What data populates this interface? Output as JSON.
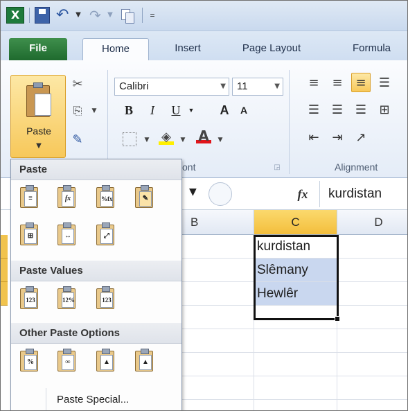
{
  "qat": {
    "custom_arrow": "="
  },
  "tabs": {
    "file": "File",
    "home": "Home",
    "insert": "Insert",
    "page_layout": "Page Layout",
    "formulas": "Formula"
  },
  "ribbon": {
    "paste_label": "Paste",
    "font_name": "Calibri",
    "font_size": "11",
    "bold": "B",
    "italic": "I",
    "underline": "U",
    "grow": "A",
    "shrink": "A",
    "font_color": "A",
    "font_group": "ont",
    "alignment_group": "Alignment"
  },
  "formula_bar": {
    "fx": "fx",
    "value": "kurdistan"
  },
  "columns": [
    "B",
    "C",
    "D"
  ],
  "cells": {
    "c1": "kurdistan",
    "c2": "Slêmany",
    "c3": "Hewlêr"
  },
  "menu": {
    "sections": [
      "Paste",
      "Paste Values",
      "Other Paste Options"
    ],
    "paste_special": "Paste Special..."
  },
  "colors": {
    "accent": "#f7c85a",
    "file_tab": "#1f6a2e",
    "selection": "#c9d7ef"
  }
}
